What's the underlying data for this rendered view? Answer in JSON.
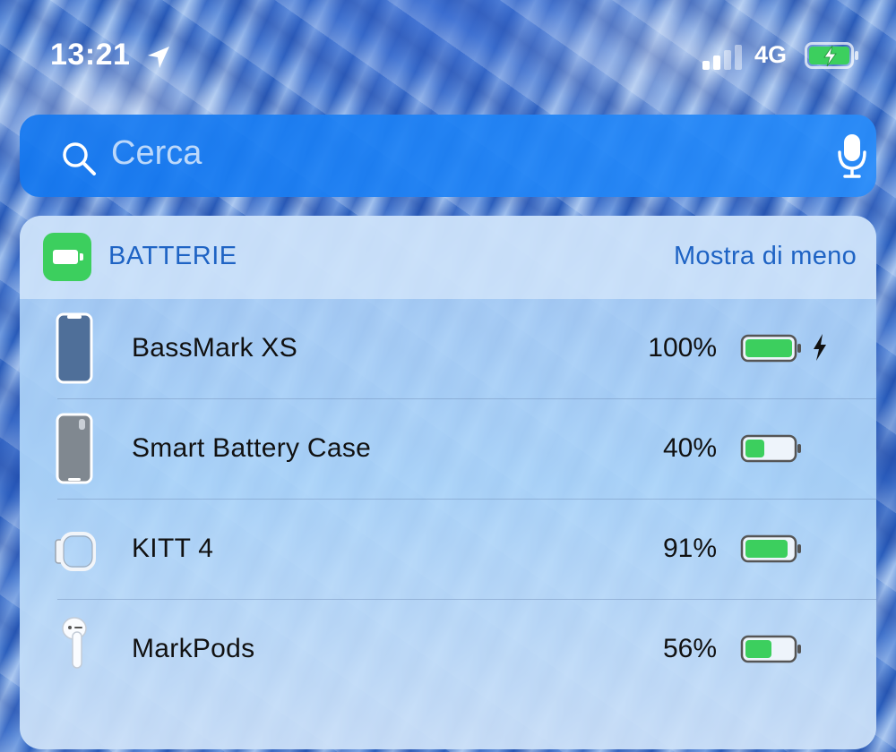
{
  "status_bar": {
    "time": "13:21",
    "network": "4G",
    "battery_charging": true
  },
  "search": {
    "placeholder": "Cerca"
  },
  "widget": {
    "title": "BATTERIE",
    "toggle_label": "Mostra di meno",
    "accent_color": "#1e63c4",
    "battery_green": "#3ccf5e"
  },
  "devices": [
    {
      "name": "BassMark XS",
      "percent_label": "100%",
      "level": 1.0,
      "charging": true,
      "icon": "iphone-icon"
    },
    {
      "name": "Smart Battery Case",
      "percent_label": "40%",
      "level": 0.4,
      "charging": false,
      "icon": "battery-case-icon"
    },
    {
      "name": "KITT 4",
      "percent_label": "91%",
      "level": 0.91,
      "charging": false,
      "icon": "watch-icon"
    },
    {
      "name": "MarkPods",
      "percent_label": "56%",
      "level": 0.56,
      "charging": false,
      "icon": "airpod-icon"
    }
  ]
}
